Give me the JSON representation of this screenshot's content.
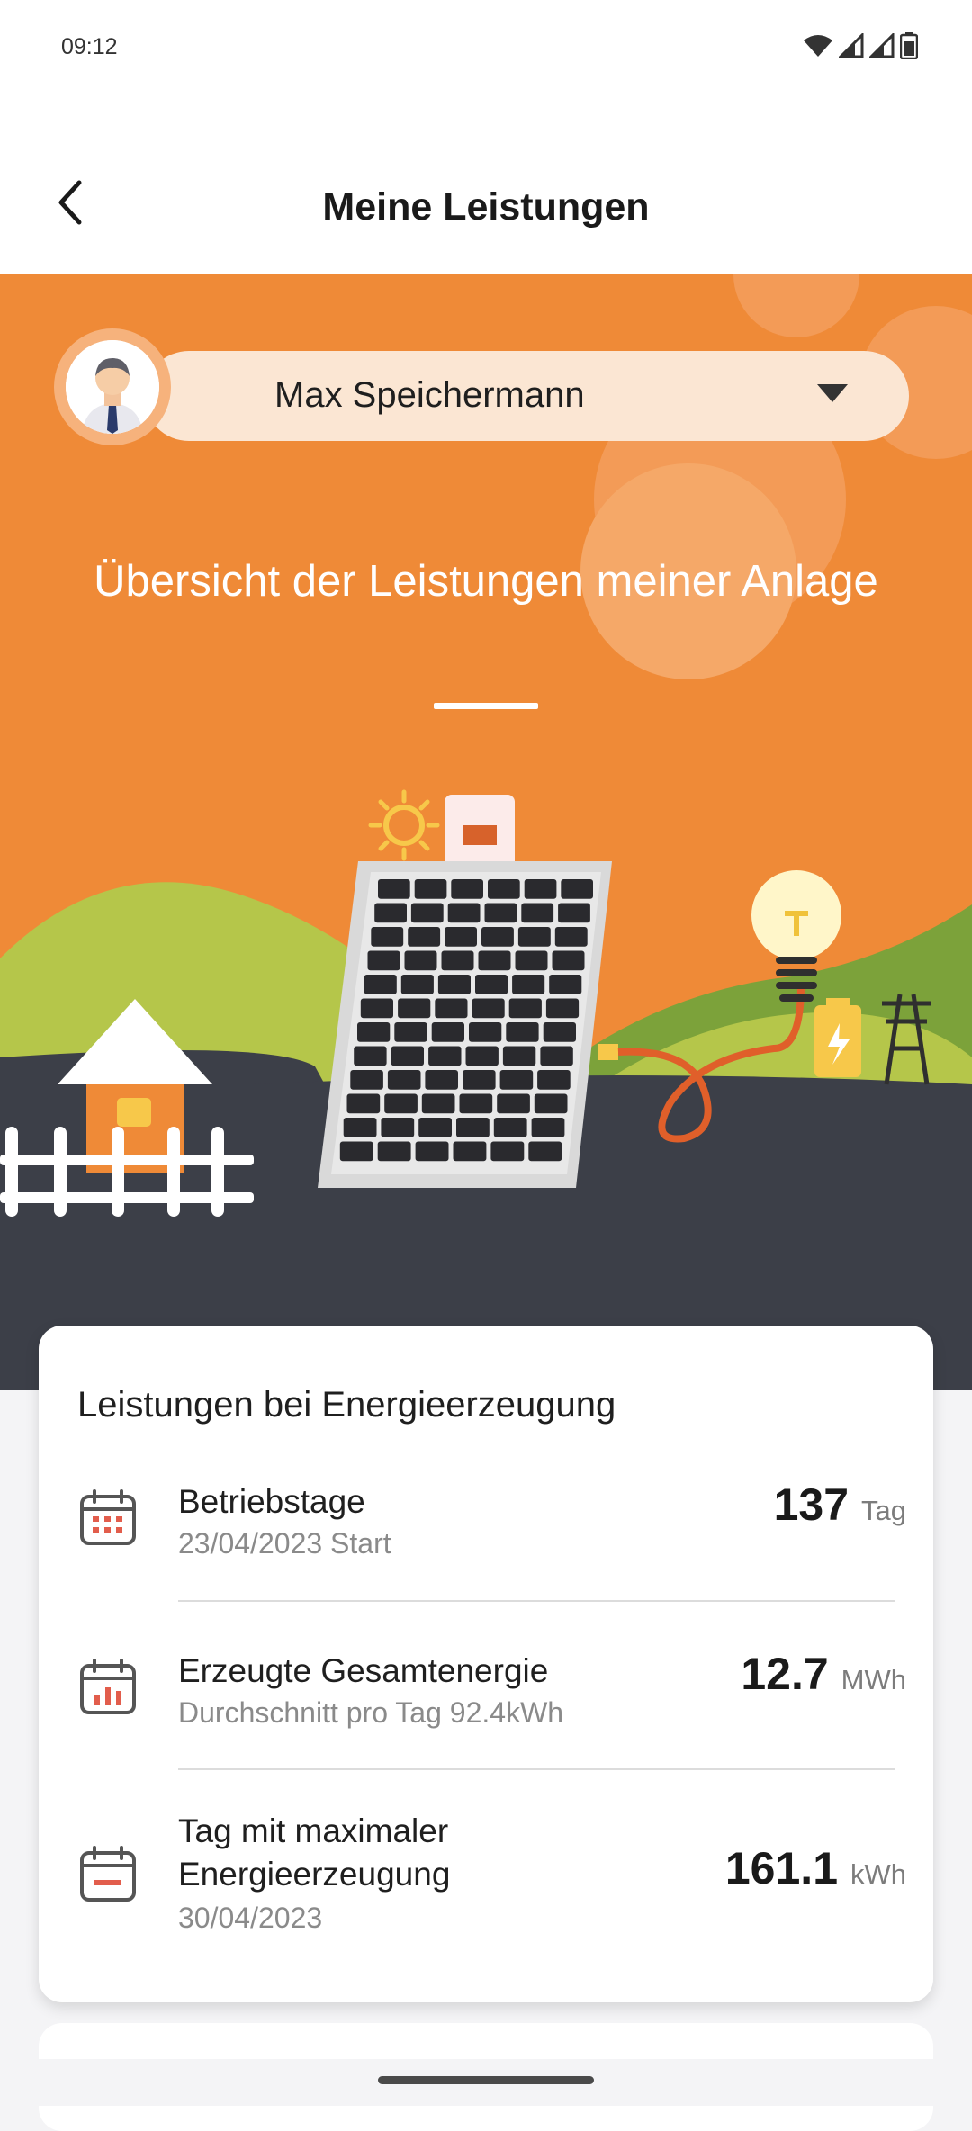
{
  "status_bar": {
    "time": "09:12",
    "icons": [
      "wifi-icon",
      "signal-icon",
      "signal-icon",
      "battery-icon"
    ]
  },
  "header": {
    "title": "Meine Leistungen",
    "back_icon": "chevron-left-icon"
  },
  "hero": {
    "user_name": "Max Speichermann",
    "dropdown_icon": "caret-down-icon",
    "title": "Übersicht der Leistungen meiner Anlage",
    "illustration": "solar-system-illustration"
  },
  "colors": {
    "accent": "#ef8a37",
    "ground": "#3c3f48",
    "hill": "#b5c64a",
    "card": "#ffffff",
    "icon_red": "#e25d4c"
  },
  "performance_card": {
    "title": "Leistungen bei Energieerzeugung",
    "rows": [
      {
        "icon": "calendar-dots-icon",
        "label": "Betriebstage",
        "sub": "23/04/2023 Start",
        "value": "137",
        "unit": "Tag"
      },
      {
        "icon": "calendar-chart-icon",
        "label": "Erzeugte Gesamtenergie",
        "sub": "Durchschnitt pro Tag 92.4kWh",
        "value": "12.7",
        "unit": "MWh"
      },
      {
        "icon": "calendar-minus-icon",
        "label_line1": "Tag mit maximaler",
        "label_line2": "Energieerzeugung",
        "sub": "30/04/2023",
        "value": "161.1",
        "unit": "kWh"
      }
    ]
  }
}
